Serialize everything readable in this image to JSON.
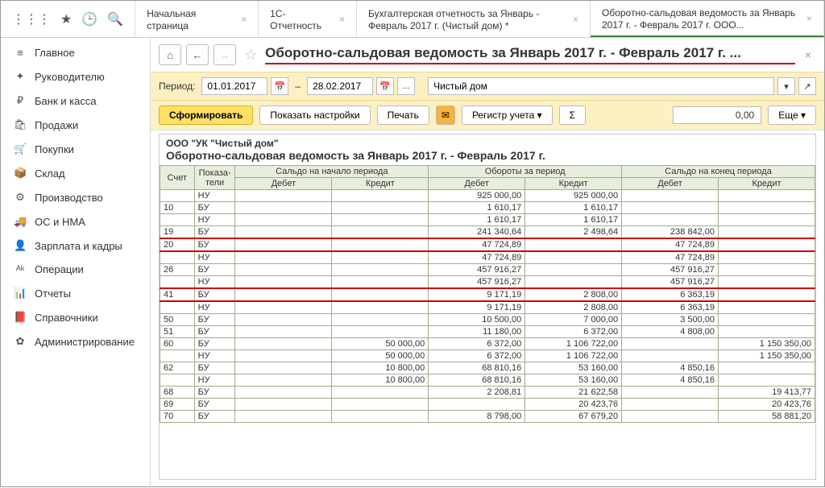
{
  "tabs": [
    {
      "label": "Начальная страница"
    },
    {
      "label": "1С-Отчетность"
    },
    {
      "label": "Бухгалтерская отчетность за Январь - Февраль 2017 г. (Чистый дом) *"
    },
    {
      "label": "Оборотно-сальдовая ведомость за Январь 2017 г. - Февраль 2017 г. ООО..."
    }
  ],
  "nav": [
    {
      "icon": "≡",
      "label": "Главное"
    },
    {
      "icon": "✦",
      "label": "Руководителю"
    },
    {
      "icon": "₽",
      "label": "Банк и касса"
    },
    {
      "icon": "🛍",
      "label": "Продажи"
    },
    {
      "icon": "🛒",
      "label": "Покупки"
    },
    {
      "icon": "📦",
      "label": "Склад"
    },
    {
      "icon": "⚙",
      "label": "Производство"
    },
    {
      "icon": "🚚",
      "label": "ОС и НМА"
    },
    {
      "icon": "👤",
      "label": "Зарплата и кадры"
    },
    {
      "icon": "ᴬᵏ",
      "label": "Операции"
    },
    {
      "icon": "📊",
      "label": "Отчеты"
    },
    {
      "icon": "📕",
      "label": "Справочники"
    },
    {
      "icon": "✿",
      "label": "Администрирование"
    }
  ],
  "title": "Оборотно-сальдовая ведомость за Январь 2017 г. - Февраль 2017 г. ...",
  "period": {
    "label": "Период:",
    "from": "01.01.2017",
    "dash": "–",
    "to": "28.02.2017",
    "dots": "...",
    "org": "Чистый дом"
  },
  "toolbar": {
    "form": "Сформировать",
    "settings": "Показать настройки",
    "print": "Печать",
    "register": "Регистр учета",
    "sigma": "Σ",
    "amount": "0,00",
    "more": "Еще"
  },
  "report": {
    "org": "ООО \"УК \"Чистый дом\"",
    "title": "Оборотно-сальдовая ведомость за Январь 2017 г. - Февраль 2017 г.",
    "headers": {
      "acc": "Счет",
      "ind": "Показа-\nтели",
      "g1": "Сальдо на начало периода",
      "g2": "Обороты за период",
      "g3": "Сальдо на конец периода",
      "deb": "Дебет",
      "cred": "Кредит"
    },
    "rows": [
      {
        "acc": "",
        "ind": "НУ",
        "c": [
          "",
          "",
          "925 000,00",
          "925 000,00",
          "",
          ""
        ]
      },
      {
        "acc": "10",
        "ind": "БУ",
        "c": [
          "",
          "",
          "1 610,17",
          "1 610,17",
          "",
          ""
        ]
      },
      {
        "acc": "",
        "ind": "НУ",
        "c": [
          "",
          "",
          "1 610,17",
          "1 610,17",
          "",
          ""
        ]
      },
      {
        "acc": "19",
        "ind": "БУ",
        "c": [
          "",
          "",
          "241 340,64",
          "2 498,64",
          "238 842,00",
          ""
        ]
      },
      {
        "acc": "20",
        "ind": "БУ",
        "c": [
          "",
          "",
          "47 724,89",
          "",
          "47 724,89",
          ""
        ],
        "red": true
      },
      {
        "acc": "",
        "ind": "НУ",
        "c": [
          "",
          "",
          "47 724,89",
          "",
          "47 724,89",
          ""
        ]
      },
      {
        "acc": "26",
        "ind": "БУ",
        "c": [
          "",
          "",
          "457 916,27",
          "",
          "457 916,27",
          ""
        ]
      },
      {
        "acc": "",
        "ind": "НУ",
        "c": [
          "",
          "",
          "457 916,27",
          "",
          "457 916,27",
          ""
        ]
      },
      {
        "acc": "41",
        "ind": "БУ",
        "c": [
          "",
          "",
          "9 171,19",
          "2 808,00",
          "6 363,19",
          ""
        ],
        "red": true
      },
      {
        "acc": "",
        "ind": "НУ",
        "c": [
          "",
          "",
          "9 171,19",
          "2 808,00",
          "6 363,19",
          ""
        ]
      },
      {
        "acc": "50",
        "ind": "БУ",
        "c": [
          "",
          "",
          "10 500,00",
          "7 000,00",
          "3 500,00",
          ""
        ]
      },
      {
        "acc": "51",
        "ind": "БУ",
        "c": [
          "",
          "",
          "11 180,00",
          "6 372,00",
          "4 808,00",
          ""
        ]
      },
      {
        "acc": "60",
        "ind": "БУ",
        "c": [
          "",
          "50 000,00",
          "6 372,00",
          "1 106 722,00",
          "",
          "1 150 350,00"
        ]
      },
      {
        "acc": "",
        "ind": "НУ",
        "c": [
          "",
          "50 000,00",
          "6 372,00",
          "1 106 722,00",
          "",
          "1 150 350,00"
        ]
      },
      {
        "acc": "62",
        "ind": "БУ",
        "c": [
          "",
          "10 800,00",
          "68 810,16",
          "53 160,00",
          "4 850,16",
          ""
        ]
      },
      {
        "acc": "",
        "ind": "НУ",
        "c": [
          "",
          "10 800,00",
          "68 810,16",
          "53 160,00",
          "4 850,16",
          ""
        ]
      },
      {
        "acc": "68",
        "ind": "БУ",
        "c": [
          "",
          "",
          "2 208,81",
          "21 622,58",
          "",
          "19 413,77"
        ]
      },
      {
        "acc": "69",
        "ind": "БУ",
        "c": [
          "",
          "",
          "",
          "20 423,76",
          "",
          "20 423,76"
        ]
      },
      {
        "acc": "70",
        "ind": "БУ",
        "c": [
          "",
          "",
          "8 798,00",
          "67 679,20",
          "",
          "58 881,20"
        ]
      }
    ]
  }
}
